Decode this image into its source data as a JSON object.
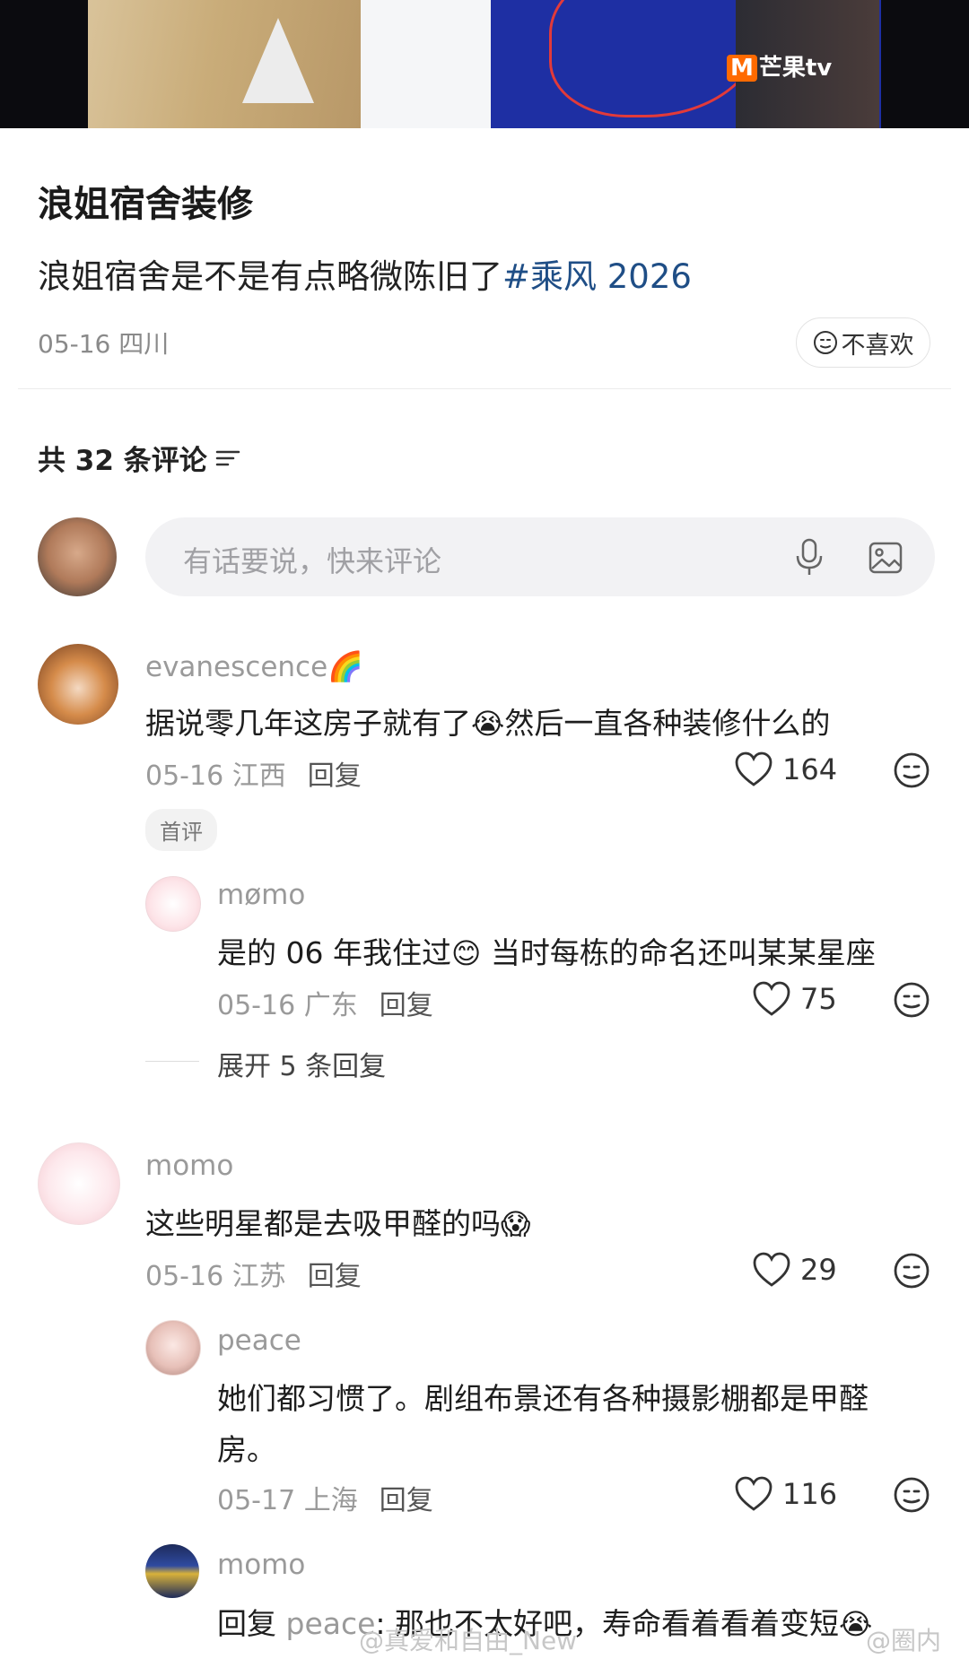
{
  "video": {
    "logo": "芒果tv",
    "logo_mark": "M"
  },
  "post": {
    "title": "浪姐宿舍装修",
    "description": "浪姐宿舍是不是有点略微陈旧了",
    "hashtag": "#乘风 2026",
    "meta": "05-16 四川",
    "dislike_label": "不喜欢"
  },
  "comments_header": {
    "count_label": "共 32 条评论"
  },
  "comment_input": {
    "placeholder": "有话要说，快来评论"
  },
  "comments": [
    {
      "user": "evanescence",
      "user_emoji": "🌈",
      "text_before": "据说零几年这房子就有了",
      "emoji": "😭",
      "text_after": "然后一直各种装修什么的",
      "meta": "05-16 江西",
      "reply_label": "回复",
      "likes": "164",
      "badge": "首评",
      "replies": [
        {
          "user": "mømo",
          "text_before": "是的 06 年我住过",
          "emoji": "😊",
          "text_after": " 当时每栋的命名还叫某某星座",
          "meta": "05-16 广东",
          "reply_label": "回复",
          "likes": "75"
        }
      ],
      "expand_label": "展开 5 条回复"
    },
    {
      "user": "momo",
      "text_before": "这些明星都是去吸甲醛的吗",
      "emoji": "😱",
      "meta": "05-16 江苏",
      "reply_label": "回复",
      "likes": "29",
      "replies": [
        {
          "user": "peace",
          "text_line1": "她们都习惯了。剧组布景还有各种摄影棚都是甲醛",
          "text_line2": "房。",
          "meta": "05-17 上海",
          "reply_label": "回复",
          "likes": "116"
        },
        {
          "user": "momo",
          "reply_prefix": "回复 ",
          "reply_to": "peace",
          "text": ": 那也不太好吧，寿命看着看着变短",
          "emoji": "😭"
        }
      ]
    }
  ],
  "watermarks": {
    "left": "@真爱和自由_New",
    "right": "@圈内"
  }
}
